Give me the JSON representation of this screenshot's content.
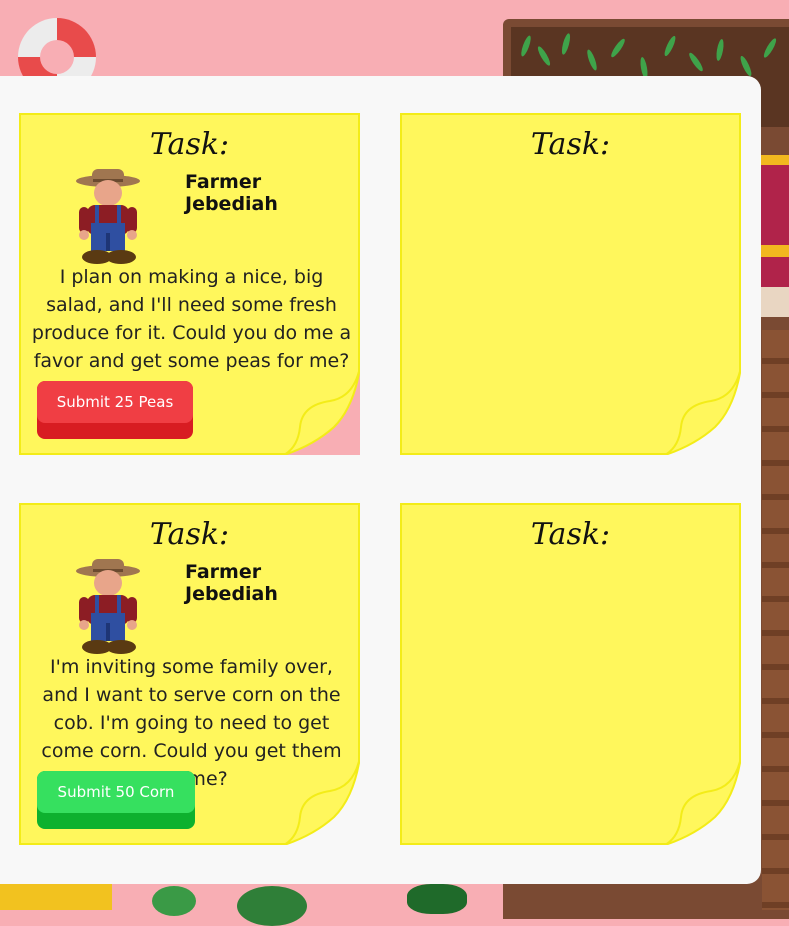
{
  "colors": {
    "background": "#f8aeb4",
    "note": "#fff75c",
    "note_border": "#f3ec18",
    "submit_red": "#f03e44",
    "submit_green": "#36e05f"
  },
  "icons": {
    "help": "lifebuoy-icon",
    "farmer": "farmer-avatar"
  },
  "tasks": [
    {
      "title": "Task:",
      "requester": "Farmer Jebediah",
      "text": "I plan on making a nice, big salad, and I'll need some fresh produce for it. Could you do me a favor and get some peas for me?",
      "button_label": "Submit 25 Peas"
    },
    {
      "title": "Task:"
    },
    {
      "title": "Task:",
      "requester": "Farmer Jebediah",
      "text": "I'm inviting some family over, and I want to serve corn on the cob. I'm going to need to get come corn. Could you get them for me?",
      "button_label": "Submit 50 Corn"
    },
    {
      "title": "Task:"
    }
  ]
}
